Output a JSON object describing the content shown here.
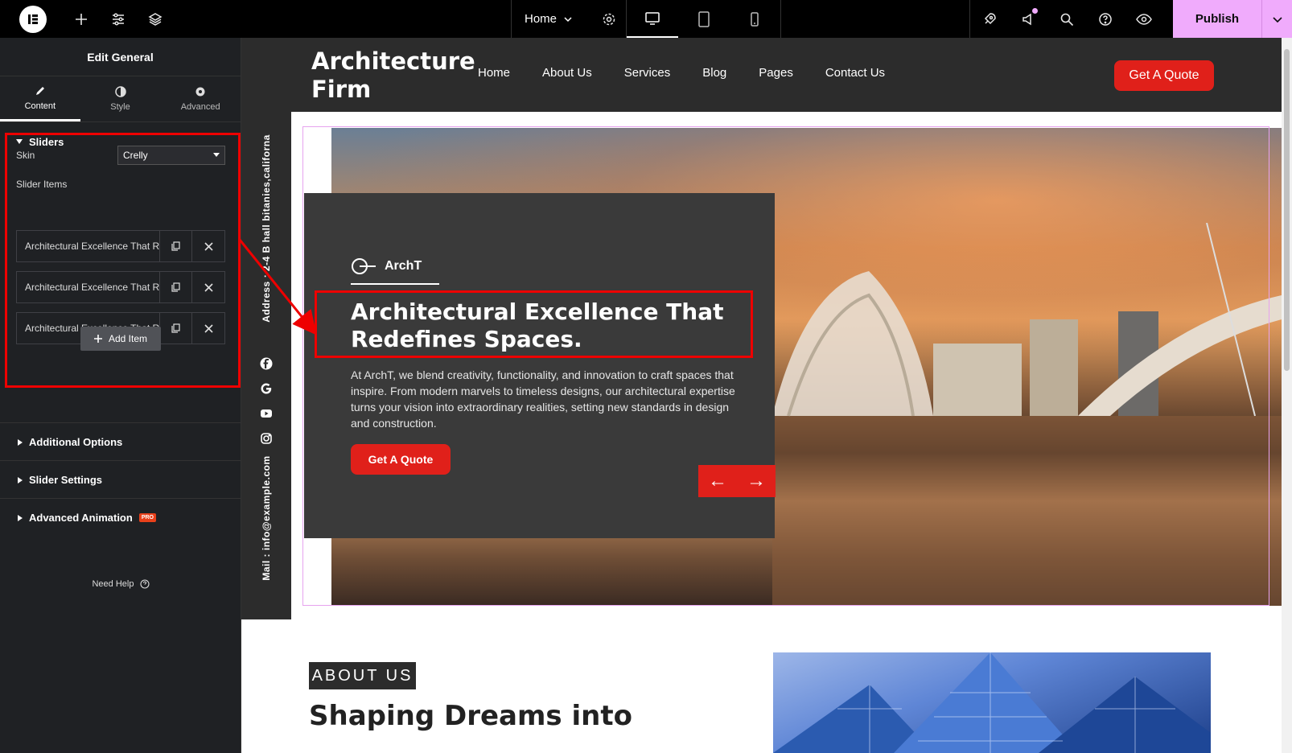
{
  "topbar": {
    "page_name": "Home",
    "publish_label": "Publish"
  },
  "panel": {
    "title": "Edit General",
    "tabs": [
      "Content",
      "Style",
      "Advanced"
    ],
    "sliders_section": "Sliders",
    "skin_label": "Skin",
    "skin_value": "Crelly",
    "slider_items_label": "Slider Items",
    "slider_items": [
      "Architectural Excellence That R",
      "Architectural Excellence That R",
      "Architectural Excellence That R"
    ],
    "add_item_label": "Add Item",
    "sections": [
      "Additional Options",
      "Slider Settings",
      "Advanced Animation"
    ],
    "pro_badge": "PRO",
    "need_help": "Need Help"
  },
  "site": {
    "title_line1": "Architecture",
    "title_line2": "Firm",
    "nav": [
      "Home",
      "About Us",
      "Services",
      "Blog",
      "Pages",
      "Contact Us"
    ],
    "quote_label": "Get A Quote",
    "address": "Address : 2-4 B hall bitanies,californa",
    "mail": "Mail : info@example.com"
  },
  "hero": {
    "brand": "ArchT",
    "headline": "Architectural Excellence That Redefines Spaces.",
    "description": "At ArchT, we blend creativity, functionality, and innovation to craft spaces that inspire. From modern marvels to timeless designs, our architectural expertise turns your vision into extraordinary realities, setting new standards in design and construction.",
    "button_label": "Get A Quote",
    "prev_arrow": "←",
    "next_arrow": "→"
  },
  "about": {
    "label": "ABOUT US",
    "title": "Shaping Dreams into"
  },
  "colors": {
    "accent_red": "#e0201a",
    "publish_pink": "#f0abfc",
    "annotation_red": "#ee0000"
  }
}
